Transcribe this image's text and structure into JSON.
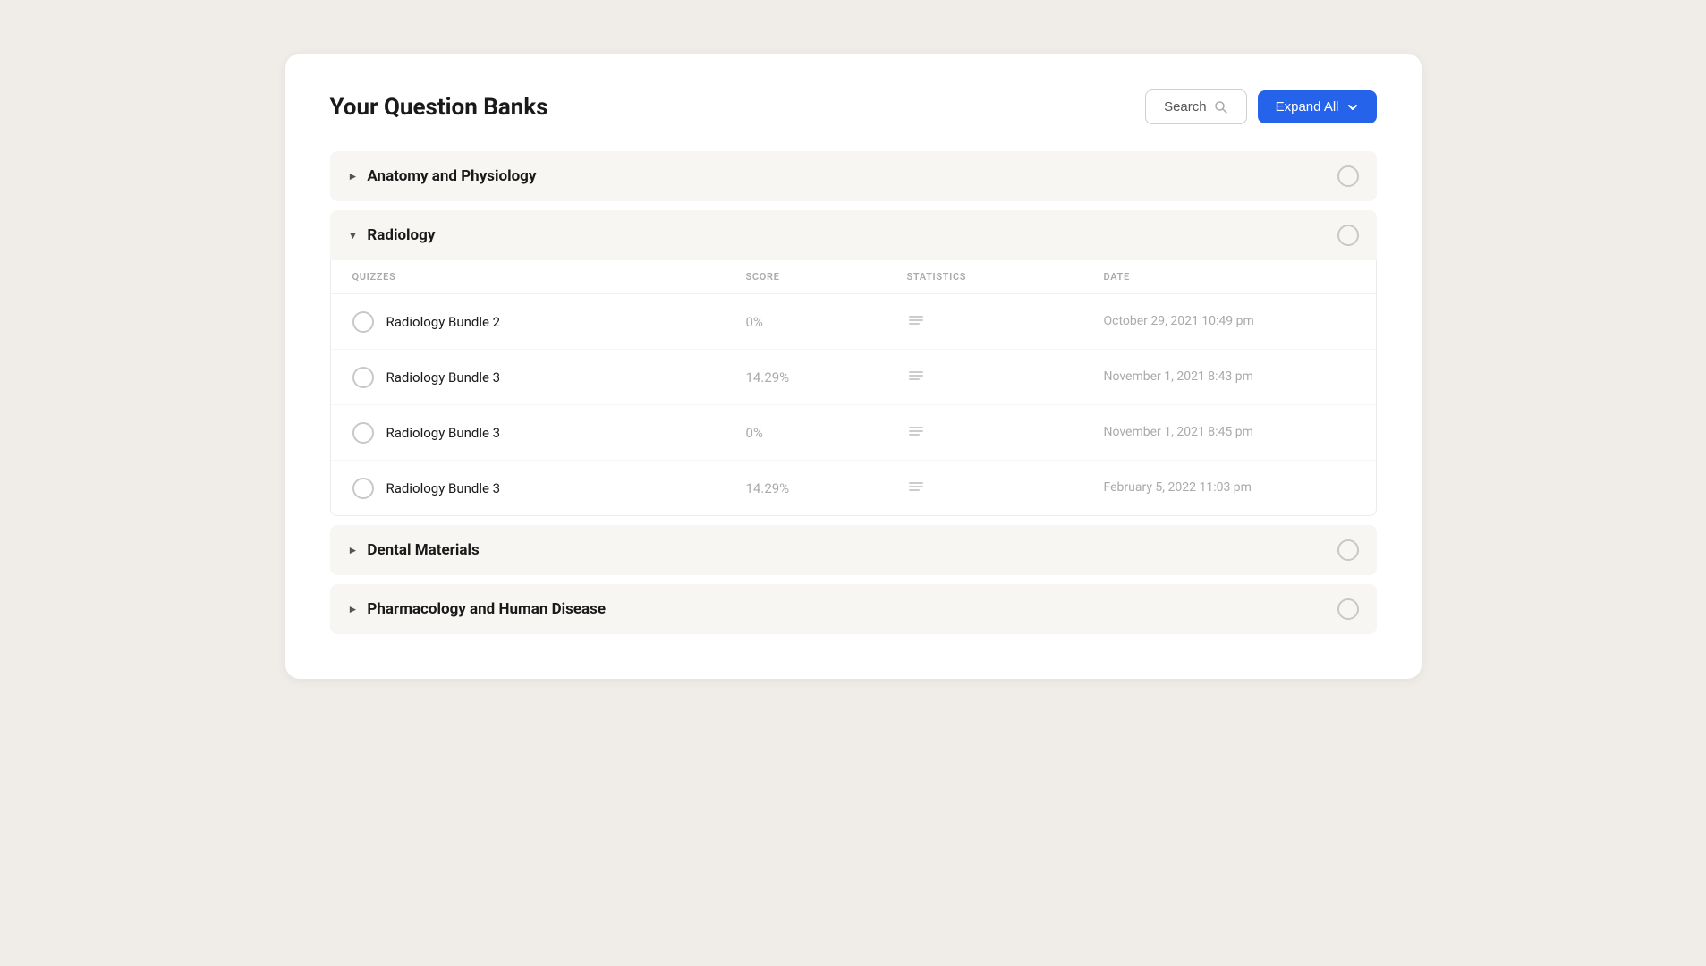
{
  "page": {
    "title": "Your Question Banks",
    "search_label": "Search",
    "expand_all_label": "Expand All"
  },
  "sections": [
    {
      "id": "anatomy",
      "name": "Anatomy and Physiology",
      "expanded": false,
      "quizzes": []
    },
    {
      "id": "radiology",
      "name": "Radiology",
      "expanded": true,
      "columns": {
        "quizzes": "QUIZZES",
        "score": "SCORE",
        "statistics": "STATISTICS",
        "date": "DATE"
      },
      "quizzes": [
        {
          "name": "Radiology Bundle 2",
          "score": "0%",
          "date": "October 29, 2021 10:49 pm"
        },
        {
          "name": "Radiology Bundle 3",
          "score": "14.29%",
          "date": "November 1, 2021 8:43 pm"
        },
        {
          "name": "Radiology Bundle 3",
          "score": "0%",
          "date": "November 1, 2021 8:45 pm"
        },
        {
          "name": "Radiology Bundle 3",
          "score": "14.29%",
          "date": "February 5, 2022 11:03 pm"
        }
      ]
    },
    {
      "id": "dental",
      "name": "Dental Materials",
      "expanded": false,
      "quizzes": []
    },
    {
      "id": "pharmacology",
      "name": "Pharmacology and Human Disease",
      "expanded": false,
      "quizzes": []
    }
  ]
}
